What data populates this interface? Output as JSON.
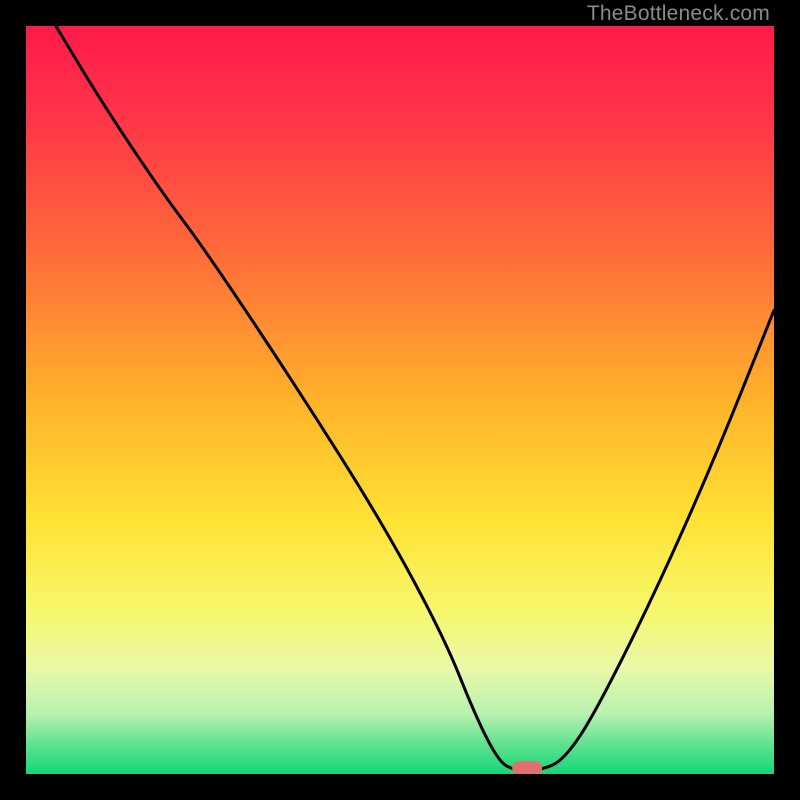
{
  "watermark": "TheBottleneck.com",
  "chart_data": {
    "type": "line",
    "title": "",
    "xlabel": "",
    "ylabel": "",
    "xlim": [
      0,
      100
    ],
    "ylim": [
      0,
      100
    ],
    "series": [
      {
        "name": "bottleneck-curve",
        "x": [
          4,
          10,
          18,
          24,
          36,
          48,
          56,
          60,
          63,
          65,
          69,
          72,
          76,
          84,
          92,
          100
        ],
        "y": [
          100,
          90,
          78,
          70,
          52,
          33,
          18,
          8,
          2,
          0.5,
          0.5,
          2,
          8,
          24,
          42,
          62
        ]
      }
    ],
    "marker": {
      "x": 67,
      "y": 0.5
    },
    "gradient_stops": [
      {
        "offset": 0,
        "color": "#ff1a4b"
      },
      {
        "offset": 12,
        "color": "#ff3448"
      },
      {
        "offset": 30,
        "color": "#ff6a3a"
      },
      {
        "offset": 50,
        "color": "#ffb22a"
      },
      {
        "offset": 66,
        "color": "#ffe233"
      },
      {
        "offset": 78,
        "color": "#f7f76a"
      },
      {
        "offset": 86,
        "color": "#e8f8a8"
      },
      {
        "offset": 92,
        "color": "#b8f0b0"
      },
      {
        "offset": 96,
        "color": "#5fe28f"
      },
      {
        "offset": 100,
        "color": "#14d67a"
      }
    ]
  }
}
